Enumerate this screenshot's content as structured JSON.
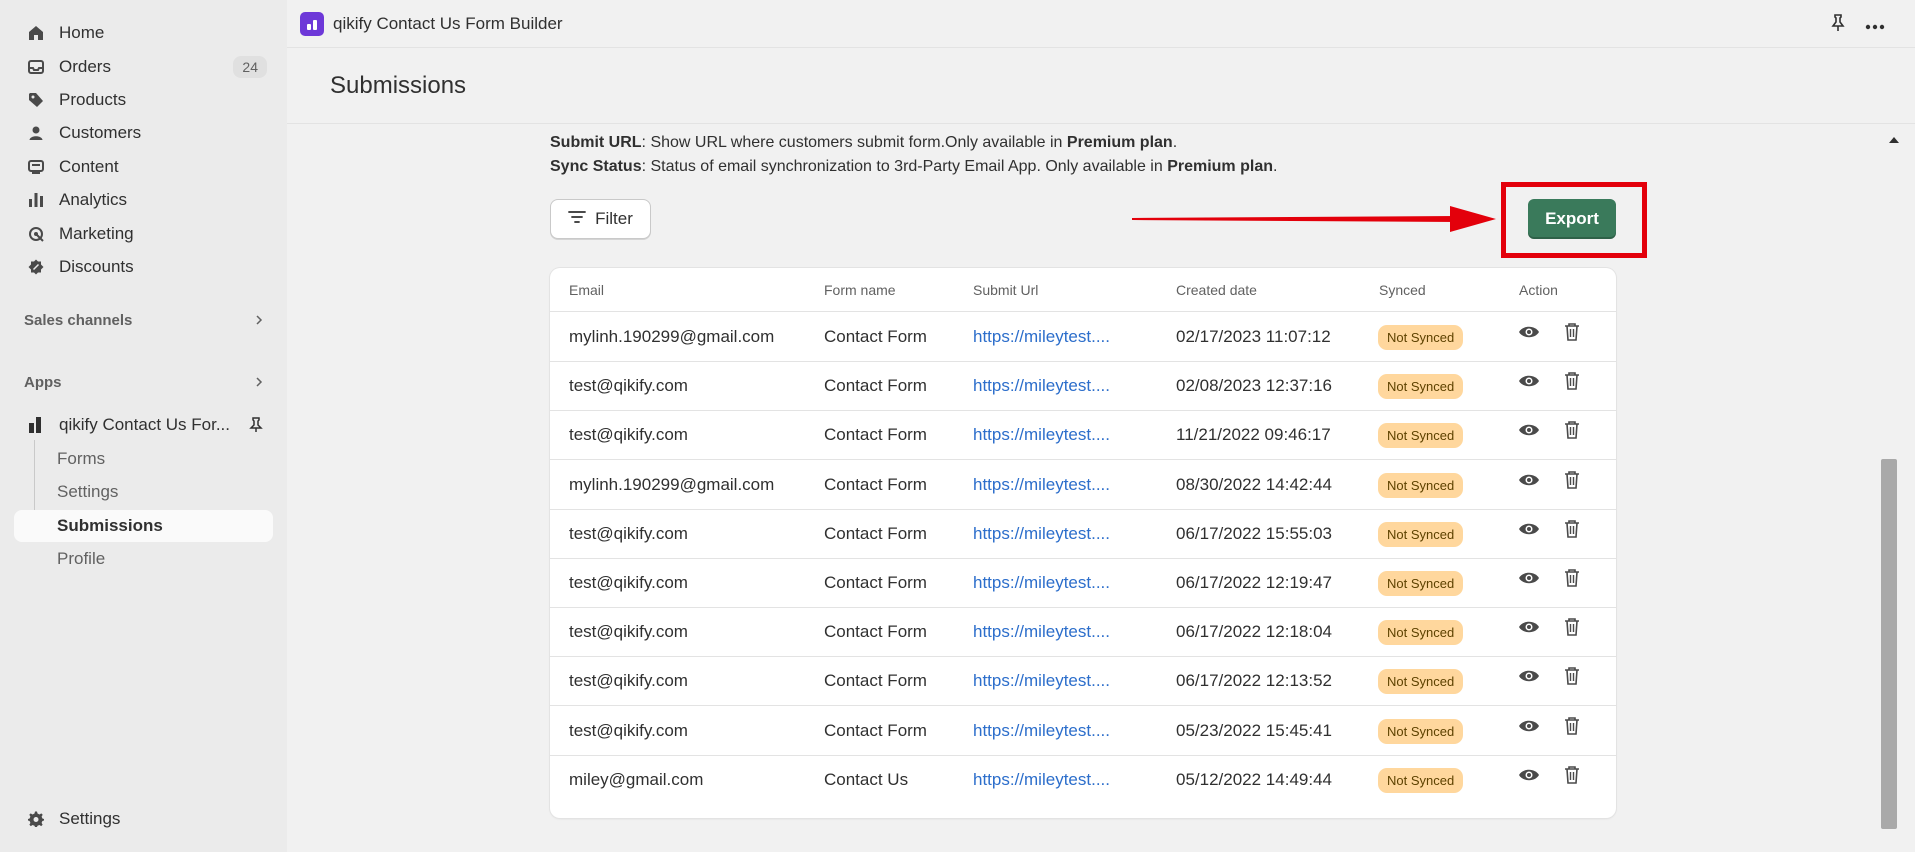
{
  "sidebar": {
    "nav": [
      {
        "label": "Home",
        "icon": "home-icon"
      },
      {
        "label": "Orders",
        "icon": "orders-icon",
        "count": "24"
      },
      {
        "label": "Products",
        "icon": "tag-icon"
      },
      {
        "label": "Customers",
        "icon": "person-icon"
      },
      {
        "label": "Content",
        "icon": "content-icon"
      },
      {
        "label": "Analytics",
        "icon": "analytics-icon"
      },
      {
        "label": "Marketing",
        "icon": "marketing-icon"
      },
      {
        "label": "Discounts",
        "icon": "discount-icon"
      }
    ],
    "sales_channels": "Sales channels",
    "apps": "Apps",
    "app_name": "qikify Contact Us For...",
    "sub_items": [
      "Forms",
      "Settings",
      "Submissions",
      "Profile"
    ],
    "settings": "Settings"
  },
  "topbar": {
    "app_title": "qikify Contact Us Form Builder"
  },
  "page": {
    "title": "Submissions",
    "info": {
      "submit_url_label": "Submit URL",
      "submit_url_text": ": Show URL where customers submit form.Only available in ",
      "sync_status_label": "Sync Status",
      "sync_status_text": ": Status of email synchronization to 3rd-Party Email App. Only available in ",
      "premium": "Premium plan",
      "period": "."
    },
    "filter_label": "Filter",
    "export_label": "Export"
  },
  "table": {
    "headers": {
      "email": "Email",
      "form_name": "Form name",
      "submit_url": "Submit Url",
      "created_date": "Created date",
      "synced": "Synced",
      "action": "Action"
    },
    "rows": [
      {
        "email": "mylinh.190299@gmail.com",
        "form": "Contact Form",
        "url": "https://mileytest....",
        "date": "02/17/2023 11:07:12",
        "synced": "Not Synced"
      },
      {
        "email": "test@qikify.com",
        "form": "Contact Form",
        "url": "https://mileytest....",
        "date": "02/08/2023 12:37:16",
        "synced": "Not Synced"
      },
      {
        "email": "test@qikify.com",
        "form": "Contact Form",
        "url": "https://mileytest....",
        "date": "11/21/2022 09:46:17",
        "synced": "Not Synced"
      },
      {
        "email": "mylinh.190299@gmail.com",
        "form": "Contact Form",
        "url": "https://mileytest....",
        "date": "08/30/2022 14:42:44",
        "synced": "Not Synced"
      },
      {
        "email": "test@qikify.com",
        "form": "Contact Form",
        "url": "https://mileytest....",
        "date": "06/17/2022 15:55:03",
        "synced": "Not Synced"
      },
      {
        "email": "test@qikify.com",
        "form": "Contact Form",
        "url": "https://mileytest....",
        "date": "06/17/2022 12:19:47",
        "synced": "Not Synced"
      },
      {
        "email": "test@qikify.com",
        "form": "Contact Form",
        "url": "https://mileytest....",
        "date": "06/17/2022 12:18:04",
        "synced": "Not Synced"
      },
      {
        "email": "test@qikify.com",
        "form": "Contact Form",
        "url": "https://mileytest....",
        "date": "06/17/2022 12:13:52",
        "synced": "Not Synced"
      },
      {
        "email": "test@qikify.com",
        "form": "Contact Form",
        "url": "https://mileytest....",
        "date": "05/23/2022 15:45:41",
        "synced": "Not Synced"
      },
      {
        "email": "miley@gmail.com",
        "form": "Contact Us",
        "url": "https://mileytest....",
        "date": "05/12/2022 14:49:44",
        "synced": "Not Synced"
      }
    ]
  },
  "colors": {
    "export_green": "#3a7a5b",
    "annotation_red": "#e3000b",
    "badge_bg": "#ffd79d",
    "link": "#2c6ecb",
    "app_logo": "#6d38d8"
  }
}
